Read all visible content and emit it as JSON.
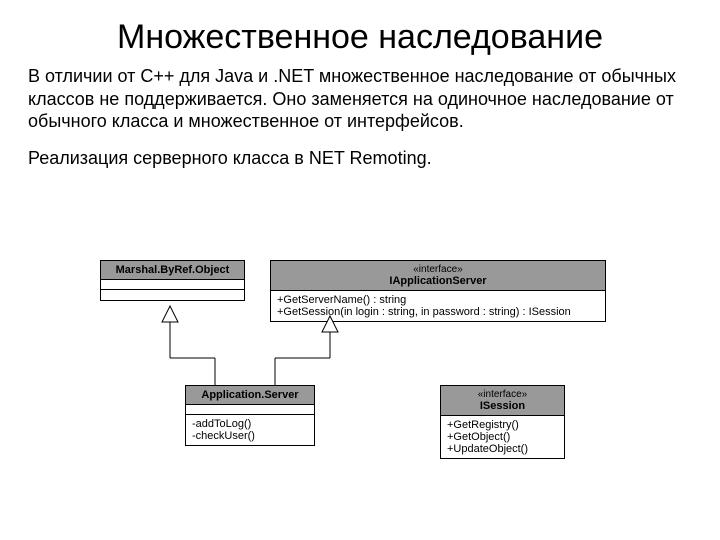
{
  "title": "Множественное наследование",
  "paragraph1": "В отличии от C++ для Java и .NET множественное наследование от обычных классов не поддерживается. Оно заменяется на одиночное наследование от обычного класса и множественное от интерфейсов.",
  "paragraph2": "Реализация серверного класса в NET Remoting.",
  "uml": {
    "marshal": {
      "name": "Marshal.ByRef.Object"
    },
    "iappserver": {
      "stereotype": "«interface»",
      "name": "IApplicationServer",
      "ops": {
        "0": "+GetServerName() : string",
        "1": "+GetSession(in login : string, in password : string) : ISession"
      }
    },
    "appserver": {
      "name": "Application.Server",
      "ops": {
        "0": "-addToLog()",
        "1": "-checkUser()"
      }
    },
    "isession": {
      "stereotype": "«interface»",
      "name": "ISession",
      "ops": {
        "0": "+GetRegistry()",
        "1": "+GetObject()",
        "2": "+UpdateObject()"
      }
    }
  }
}
